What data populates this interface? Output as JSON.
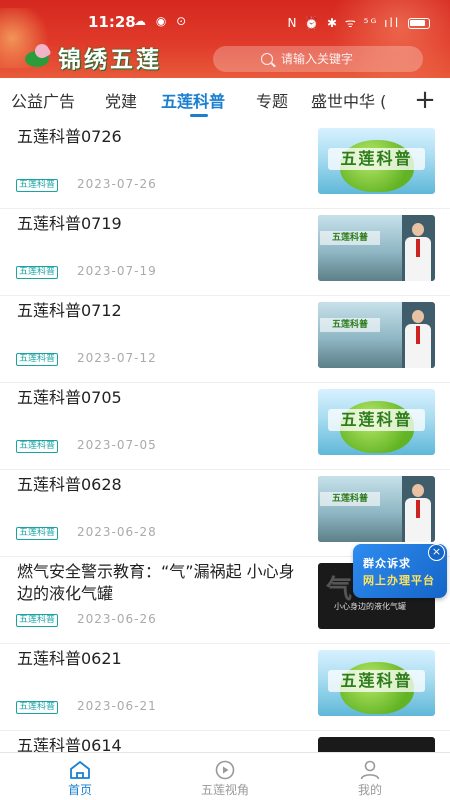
{
  "status_bar": {
    "time": "11:28",
    "left_icons": "☁ ◉ ⊙",
    "right_icons": "N ⏰ ✱ ᯤ ⁵ᴳ ıll"
  },
  "header": {
    "logo_text": "锦绣五莲",
    "search_placeholder": "请输入关键字"
  },
  "tabs": [
    {
      "label": "公益广告"
    },
    {
      "label": "党建"
    },
    {
      "label": "五莲科普"
    },
    {
      "label": "专题"
    },
    {
      "label": "盛世中华 (",
      "note_truncated": true
    }
  ],
  "tab_add": "+",
  "articles": [
    {
      "title": "五莲科普0726",
      "tag": "五莲科普",
      "date": "2023-07-26",
      "thumb_icon": "apple-logo-thumbnail",
      "thumb_text": "五莲科普"
    },
    {
      "title": "五莲科普0719",
      "tag": "五莲科普",
      "date": "2023-07-19",
      "thumb_icon": "presenter-thumbnail",
      "thumb_text": "五莲科普"
    },
    {
      "title": "五莲科普0712",
      "tag": "五莲科普",
      "date": "2023-07-12",
      "thumb_icon": "presenter-thumbnail",
      "thumb_text": "五莲科普"
    },
    {
      "title": "五莲科普0705",
      "tag": "五莲科普",
      "date": "2023-07-05",
      "thumb_icon": "apple-logo-thumbnail",
      "thumb_text": "五莲科普"
    },
    {
      "title": "五莲科普0628",
      "tag": "五莲科普",
      "date": "2023-06-28",
      "thumb_icon": "presenter-thumbnail",
      "thumb_text": "五莲科普"
    },
    {
      "title": "燃气安全警示教育：“气”漏祸起  小心身边的液化气罐",
      "tag": "五莲科普",
      "date": "2023-06-26",
      "thumb_icon": "gas-safety-thumbnail",
      "thumb_text": "气",
      "thumb_sub": "小心身边的液化气罐"
    },
    {
      "title": "五莲科普0621",
      "tag": "五莲科普",
      "date": "2023-06-21",
      "thumb_icon": "apple-logo-thumbnail",
      "thumb_text": "五莲科普"
    },
    {
      "title": "五莲科普0614",
      "tag": "",
      "date": "",
      "thumb_icon": "presenter-thumbnail",
      "thumb_text": ""
    }
  ],
  "floating_badge": {
    "line1": "群众诉求",
    "line2": "网上办理平台",
    "close": "×"
  },
  "bottom_nav": [
    {
      "label": "首页",
      "icon": "home-icon",
      "active": true
    },
    {
      "label": "五莲视角",
      "icon": "play-icon",
      "active": false
    },
    {
      "label": "我的",
      "icon": "user-icon",
      "active": false
    }
  ],
  "colors": {
    "header_red": "#d5281f",
    "accent_blue": "#1a7fd0",
    "tag_teal": "#1aa3a3",
    "date_gray": "#aaaaaa"
  }
}
